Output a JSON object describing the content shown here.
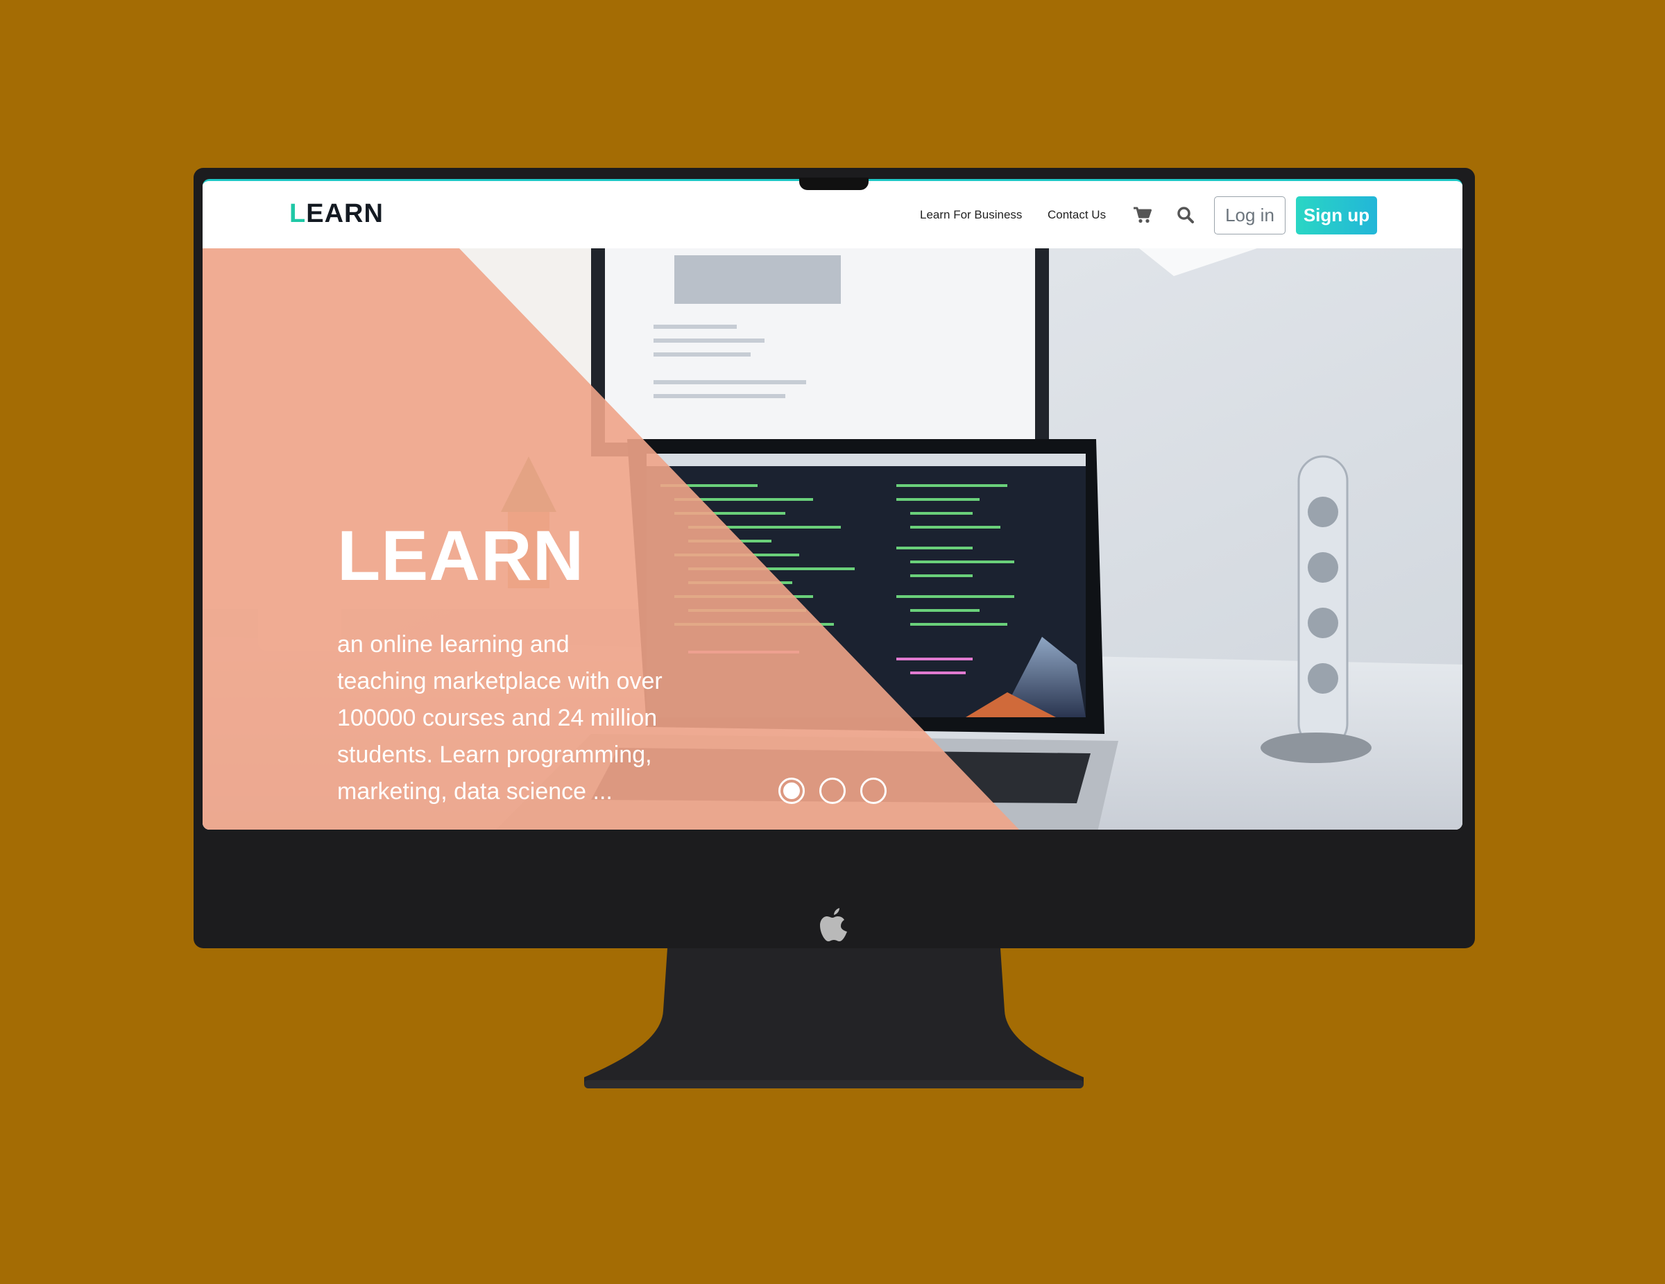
{
  "brand": {
    "first_letter": "L",
    "rest": "EARN"
  },
  "nav": {
    "learn_for_business": "Learn For Business",
    "contact_us": "Contact Us",
    "cart_icon": "cart-icon",
    "search_icon": "search-icon",
    "login_label": "Log in",
    "signup_label": "Sign up"
  },
  "hero": {
    "title": "LEARN",
    "lines": [
      "an online learning and",
      "teaching marketplace with over",
      "100000 courses and 24 million",
      "students. Learn programming,",
      "marketing, data science ..."
    ],
    "slides": 3,
    "active_slide": 1
  },
  "colors": {
    "background": "#a46c04",
    "accent": "#1fc8a6",
    "signup": "#22c6cc",
    "overlay": "#f0a488"
  }
}
